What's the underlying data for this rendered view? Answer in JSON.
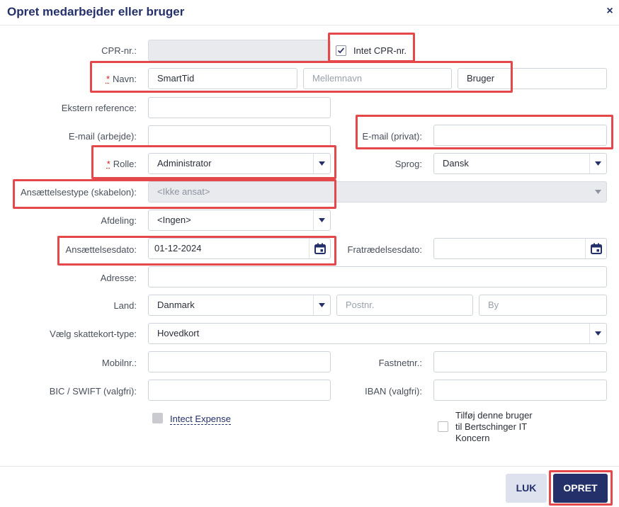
{
  "dialog": {
    "title": "Opret medarbejder eller bruger",
    "close_symbol": "×"
  },
  "fields": {
    "cpr_label": "CPR-nr.:",
    "no_cpr_label": "Intet CPR-nr.",
    "no_cpr_checked": true,
    "name_required_mark": "*",
    "name_label": "Navn:",
    "first_name_value": "SmartTid",
    "middle_name_placeholder": "Mellemnavn",
    "last_name_value": "Bruger",
    "ext_ref_label": "Ekstern reference:",
    "email_work_label": "E-mail (arbejde):",
    "email_private_label": "E-mail (privat):",
    "role_required_mark": "*",
    "role_label": "Rolle:",
    "role_value": "Administrator",
    "language_label": "Sprog:",
    "language_value": "Dansk",
    "employment_type_label": "Ansættelsestype (skabelon):",
    "employment_type_value": "<Ikke ansat>",
    "department_label": "Afdeling:",
    "department_value": "<Ingen>",
    "hire_date_label": "Ansættelsesdato:",
    "hire_date_value": "01-12-2024",
    "resign_date_label": "Fratrædelsesdato:",
    "address_label": "Adresse:",
    "country_label": "Land:",
    "country_value": "Danmark",
    "postal_placeholder": "Postnr.",
    "city_placeholder": "By",
    "tax_card_label": "Vælg skattekort-type:",
    "tax_card_value": "Hovedkort",
    "mobile_label": "Mobilnr.:",
    "landline_label": "Fastnetnr.:",
    "bic_label": "BIC / SWIFT (valgfri):",
    "iban_label": "IBAN (valgfri):",
    "intect_expense_label": "Intect Expense",
    "add_to_company_line1": "Tilføj denne bruger",
    "add_to_company_line2": "til Bertschinger IT",
    "add_to_company_line3": "Koncern"
  },
  "buttons": {
    "close_label": "LUK",
    "create_label": "OPRET"
  },
  "colors": {
    "brand": "#24306a",
    "highlight": "#e4484b",
    "required": "#d32020"
  },
  "icons": {
    "dropdown": "chevron-down-icon",
    "calendar": "calendar-icon",
    "check": "checkmark-icon"
  }
}
